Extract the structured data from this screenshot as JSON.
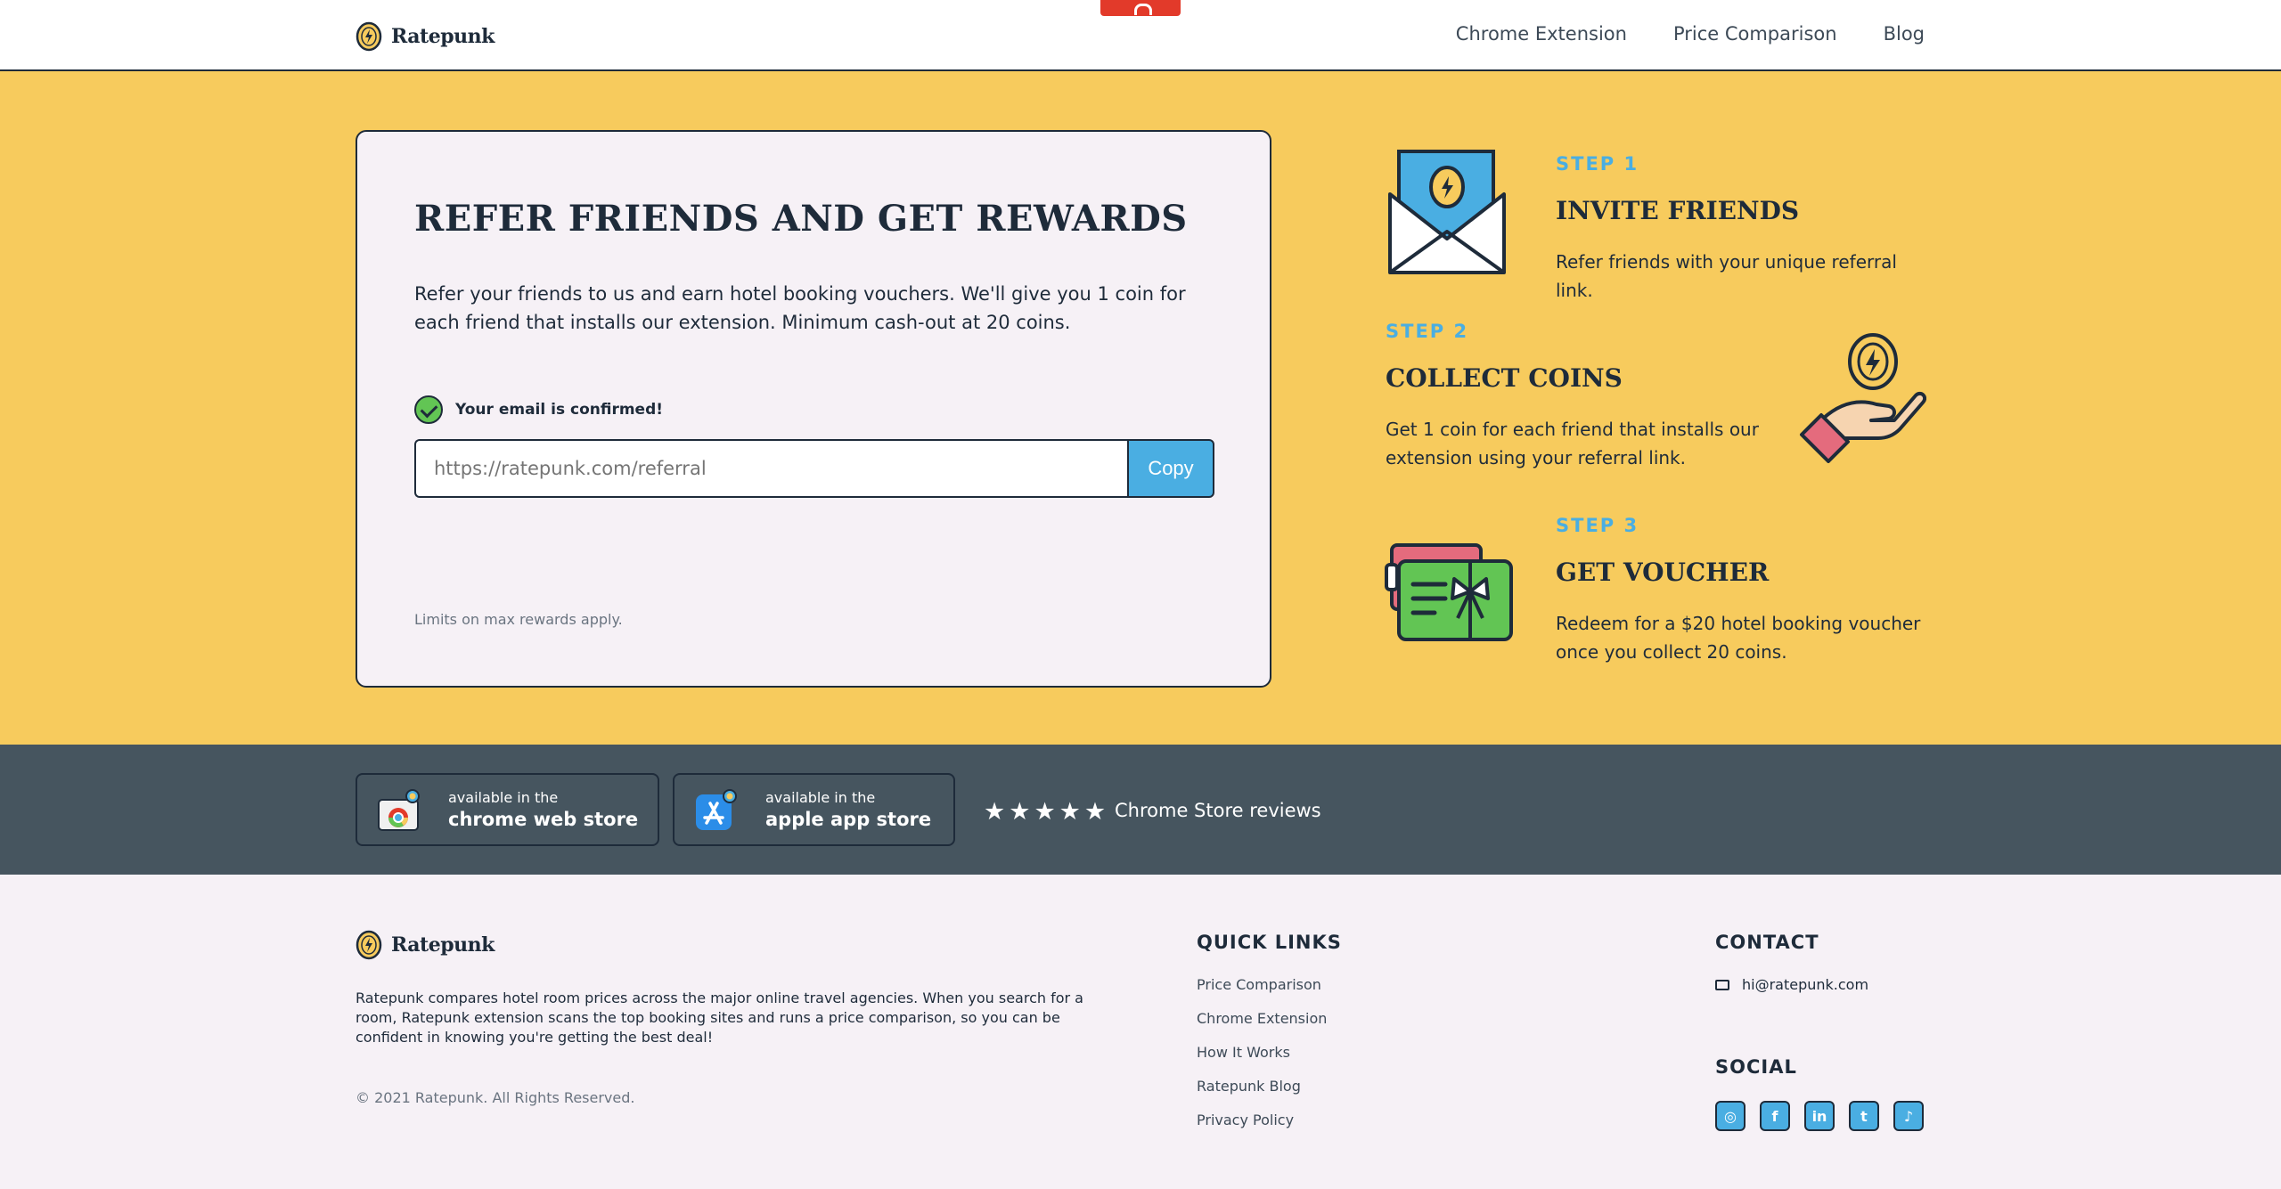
{
  "header": {
    "brand": "Ratepunk",
    "nav": [
      "Chrome Extension",
      "Price Comparison",
      "Blog"
    ]
  },
  "referral": {
    "title": "REFER FRIENDS AND GET REWARDS",
    "description": "Refer your friends to us and earn hotel booking vouchers. We'll give you 1 coin for each friend that installs our extension. Minimum cash-out at 20 coins.",
    "confirmed_text": "Your email is confirmed!",
    "link_placeholder": "https://ratepunk.com/referral",
    "copy_label": "Copy",
    "limits": "Limits on max rewards apply."
  },
  "steps": [
    {
      "label": "STEP 1",
      "title": "INVITE FRIENDS",
      "description": "Refer friends with your unique referral link.",
      "icon": "envelope-coin-icon"
    },
    {
      "label": "STEP 2",
      "title": "COLLECT COINS",
      "description": "Get 1 coin for each friend that installs our extension using your referral link.",
      "icon": "hand-coin-icon"
    },
    {
      "label": "STEP 3",
      "title": "GET VOUCHER",
      "description": "Redeem for a $20 hotel booking voucher once you collect 20 coins.",
      "icon": "gift-voucher-icon"
    }
  ],
  "badges": {
    "chrome": {
      "small": "available in the",
      "big": "chrome web store"
    },
    "apple": {
      "small": "available in the",
      "big": "apple app store"
    },
    "stars": 5,
    "reviews": "Chrome Store reviews"
  },
  "footer": {
    "brand": "Ratepunk",
    "about": "Ratepunk compares hotel room prices across the major online travel agencies. When you search for a room, Ratepunk extension scans the top booking sites and runs a price comparison, so you can be confident in knowing you're getting the best deal!",
    "copyright": "© 2021 Ratepunk. All Rights Reserved.",
    "quick_links_heading": "QUICK LINKS",
    "quick_links": [
      "Price Comparison",
      "Chrome Extension",
      "How It Works",
      "Ratepunk Blog",
      "Privacy Policy"
    ],
    "contact_heading": "CONTACT",
    "email": "hi@ratepunk.com",
    "social_heading": "SOCIAL",
    "social": [
      "instagram-icon",
      "facebook-icon",
      "linkedin-icon",
      "twitter-icon",
      "tiktok-icon"
    ]
  },
  "colors": {
    "accent": "#4aaee2",
    "hero": "#f7cb5d",
    "band": "#46555f",
    "dark": "#1e2b3a"
  }
}
